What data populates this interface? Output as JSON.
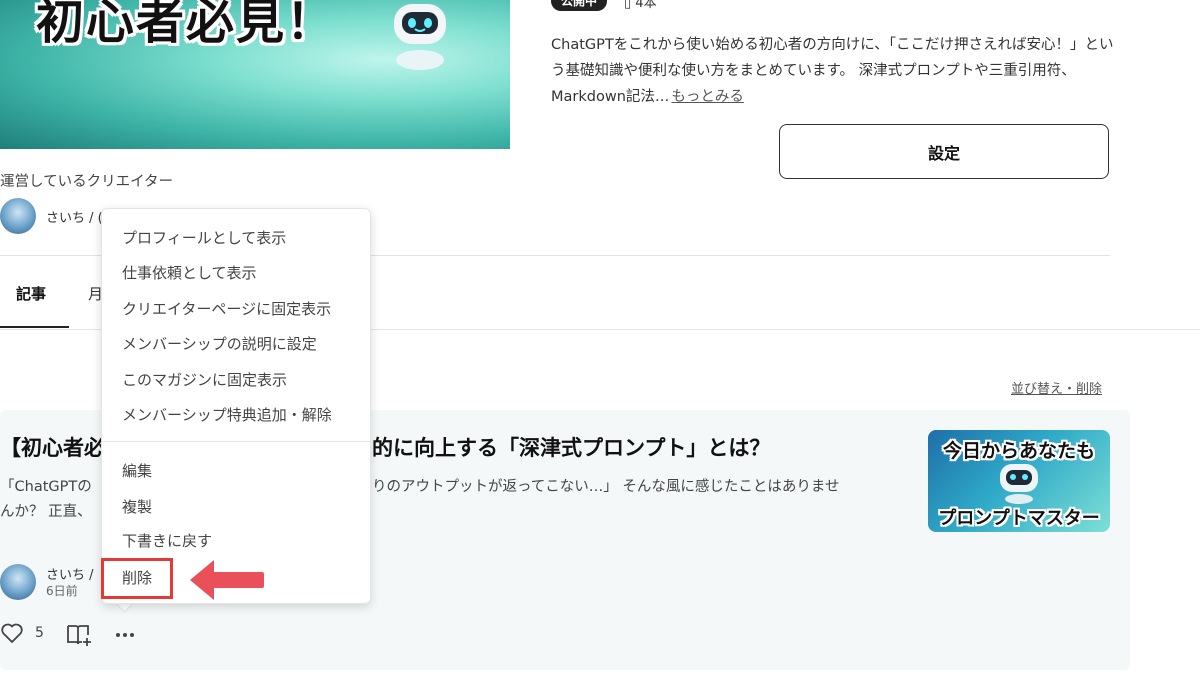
{
  "magazine": {
    "cover_title": "初心者必見！",
    "status_badge": "公開中",
    "article_count": "4本",
    "description": "ChatGPTをこれから使い始める初心者の方向けに、「ここだけ押さえれば安心！」という基礎知識や便利な使い方をまとめています。 深津式プロンプトや三重引用符、Markdown記法…",
    "more_link": "もっとみる",
    "settings_button": "設定"
  },
  "creator": {
    "section_label": "運営しているクリエイター",
    "name_partial": "さいち / ("
  },
  "tabs": {
    "active": "記事",
    "second_partial": "月"
  },
  "list": {
    "sort_link": "並び替え・削除"
  },
  "article": {
    "title_left": "【初心者必",
    "title_right": "的に向上する「深津式プロンプト」とは？",
    "excerpt_line1_left": "「ChatGPTの",
    "excerpt_line1_right": "りのアウトプットが返ってこない…」 そんな風に感じたことはありませ",
    "excerpt_line2_left": "んか？ 正直、",
    "thumb_top": "今日からあなたも",
    "thumb_bottom": "プロンプトマスター",
    "author_partial": "さいち /",
    "date": "6日前",
    "like_count": "5"
  },
  "menu": {
    "items": [
      "プロフィールとして表示",
      "仕事依頼として表示",
      "クリエイターページに固定表示",
      "メンバーシップの説明に設定",
      "このマガジンに固定表示",
      "メンバーシップ特典追加・解除",
      "編集",
      "複製",
      "下書きに戻す",
      "削除"
    ]
  },
  "colors": {
    "highlight": "#e53935",
    "arrow": "#e9505a"
  }
}
